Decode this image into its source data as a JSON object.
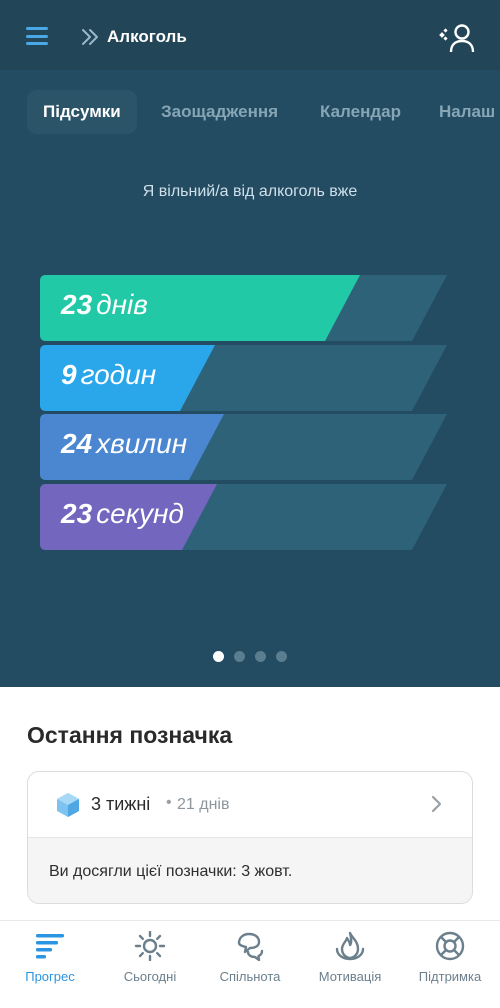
{
  "header": {
    "title": "Алкоголь"
  },
  "tabs": [
    {
      "label": "Підсумки",
      "active": true
    },
    {
      "label": "Заощадження",
      "active": false
    },
    {
      "label": "Календар",
      "active": false
    },
    {
      "label": "Налаш",
      "active": false
    }
  ],
  "summary": {
    "free_label": "Я вільний/а від алкоголь вже",
    "bars": [
      {
        "value": "23",
        "unit": "днів",
        "fill_fraction": 0.767,
        "color_from": "#22c9a6",
        "color_to": "#1fd6b4"
      },
      {
        "value": "9",
        "unit": "годин",
        "fill_fraction": 0.375,
        "color_from": "#2aa6ea",
        "color_to": "#3fbbf4"
      },
      {
        "value": "24",
        "unit": "хвилин",
        "fill_fraction": 0.4,
        "color_from": "#4b86d1",
        "color_to": "#5a99e2"
      },
      {
        "value": "23",
        "unit": "секунд",
        "fill_fraction": 0.383,
        "color_from": "#7366bf",
        "color_to": "#8478cd"
      }
    ],
    "page_dots": {
      "count": 4,
      "active_index": 0
    }
  },
  "last_badge": {
    "section_title": "Остання позначка",
    "name": "3 тижні",
    "separator": "•",
    "days": "21 днів",
    "achieved": "Ви досягли цієї позначки: 3 жовт."
  },
  "bottom_nav": [
    {
      "label": "Прогрес",
      "icon": "progress-icon",
      "active": true
    },
    {
      "label": "Сьогодні",
      "icon": "sun-icon",
      "active": false
    },
    {
      "label": "Спільнота",
      "icon": "community-icon",
      "active": false
    },
    {
      "label": "Мотивація",
      "icon": "motivation-icon",
      "active": false
    },
    {
      "label": "Підтримка",
      "icon": "lifebuoy-icon",
      "active": false
    }
  ],
  "colors": {
    "top_background": "#234b61",
    "header_background": "#224558",
    "accent": "#2a95e0"
  }
}
